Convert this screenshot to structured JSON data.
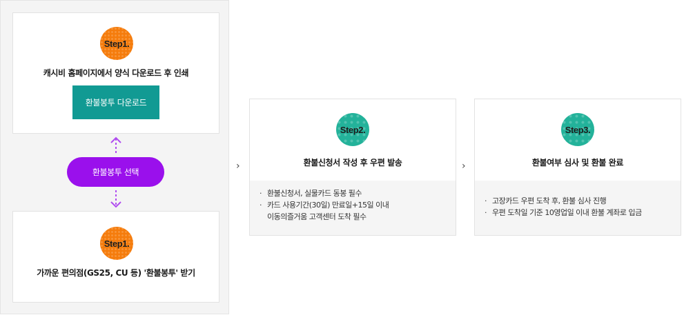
{
  "left_panel": {
    "step_top": {
      "badge": "Step1.",
      "title": "캐시비 홈페이지에서 양식 다운로드 후 인쇄",
      "button_label": "환불봉투 다운로드"
    },
    "select_label": "환불봉투 선택",
    "step_bottom": {
      "badge": "Step1.",
      "title": "가까운 편의점(GS25, CU 등) '환불봉투' 받기"
    }
  },
  "separator": "›",
  "step2": {
    "badge": "Step2.",
    "title": "환불신청서 작성 후 우편 발송",
    "notes": [
      "환불신청서, 실물카드 동봉 필수",
      "카드 사용기간(30일) 만료일+15일 이내",
      "이동의즐거움 고객센터 도착 필수"
    ]
  },
  "step3": {
    "badge": "Step3.",
    "title": "환불여부 심사 및 환불 완료",
    "notes": [
      "고장카드 우편 도착 후, 환불 심사 진행",
      "우편 도착일 기준 10영업일 이내 환불 계좌로 입금"
    ]
  },
  "colors": {
    "orange_badge": "#f57c0c",
    "teal_badge": "#23b29a",
    "download_button": "#119a93",
    "select_pill": "#9a10ec",
    "arrow": "#b04cf0"
  }
}
